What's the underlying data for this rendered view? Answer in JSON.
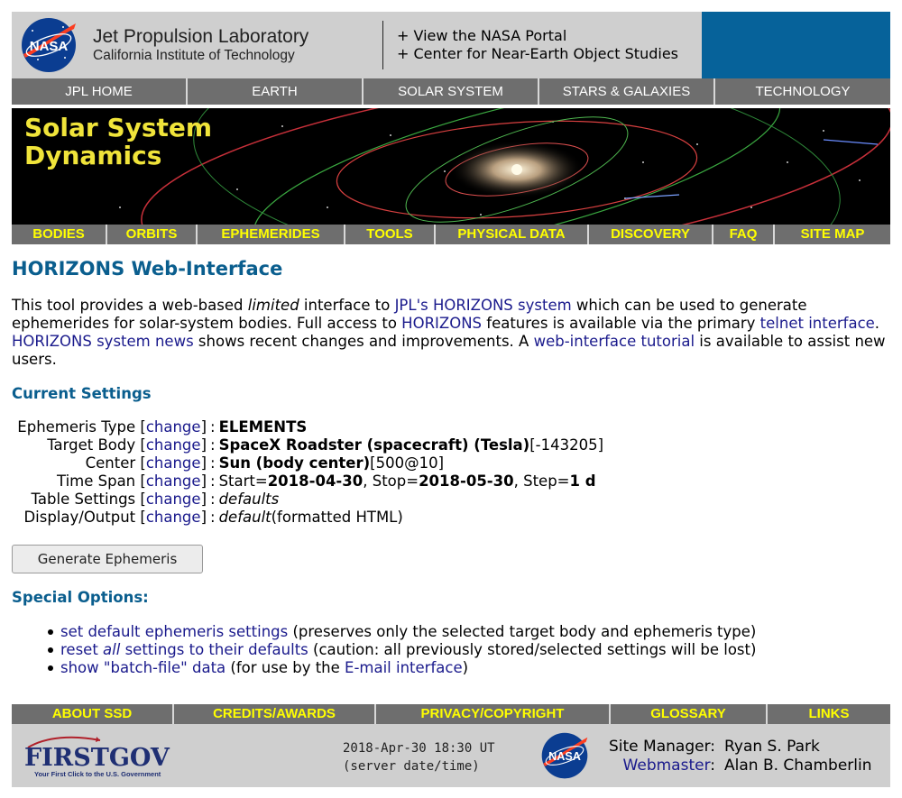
{
  "header": {
    "title": "Jet Propulsion Laboratory",
    "subtitle": "California Institute of Technology",
    "logo_text": "NASA",
    "links": [
      "+ View the NASA Portal",
      "+ Center for Near-Earth Object Studies"
    ]
  },
  "top_nav": [
    "JPL HOME",
    "EARTH",
    "SOLAR SYSTEM",
    "STARS & GALAXIES",
    "TECHNOLOGY"
  ],
  "banner": {
    "title_line1": "Solar System",
    "title_line2": "Dynamics"
  },
  "sub_nav": [
    "BODIES",
    "ORBITS",
    "EPHEMERIDES",
    "TOOLS",
    "PHYSICAL DATA",
    "DISCOVERY",
    "FAQ",
    "SITE MAP"
  ],
  "main": {
    "title": "HORIZONS Web-Interface",
    "intro": {
      "t1": "This tool provides a web-based ",
      "t2": "limited",
      "t3": " interface to ",
      "link_jpl": "JPL's HORIZONS system",
      "t4": " which can be used to generate ephemerides for solar-system bodies. Full access to ",
      "link_horizons": "HORIZONS",
      "t5": " features is available via the primary ",
      "link_telnet": "telnet interface",
      "t6": ". ",
      "link_news": "HORIZONS system news",
      "t7": " shows recent changes and improvements. A ",
      "link_tutorial": "web-interface tutorial",
      "t8": " is available to assist new users."
    },
    "current_settings_title": "Current Settings",
    "settings": {
      "open_bracket": "[",
      "close_bracket": "]",
      "change_label": "change",
      "colon": " : ",
      "ephemeris_type": {
        "label": "Ephemeris Type",
        "value": "ELEMENTS"
      },
      "target_body": {
        "label": "Target Body",
        "value": "SpaceX Roadster (spacecraft) (Tesla)",
        "extra": " [-143205]"
      },
      "center": {
        "label": "Center",
        "value": "Sun (body center)",
        "extra": " [500@10]"
      },
      "time_span": {
        "label": "Time Span",
        "start_label": "Start=",
        "start": "2018-04-30",
        "stop_label": ", Stop=",
        "stop": "2018-05-30",
        "step_label": ", Step=",
        "step": "1 d"
      },
      "table_settings": {
        "label": "Table Settings",
        "value": "defaults"
      },
      "display_output": {
        "label": "Display/Output",
        "value": "default",
        "extra": " (formatted HTML)"
      }
    },
    "generate_button": "Generate Ephemeris",
    "special_options_title": "Special Options:",
    "options": {
      "opt1_link": "set default ephemeris settings",
      "opt1_text": " (preserves only the selected target body and ephemeris type)",
      "opt2_link_a": "reset ",
      "opt2_link_b": "all",
      "opt2_link_c": " settings to their defaults",
      "opt2_text": " (caution: all previously stored/selected settings will be lost)",
      "opt3_link": "show \"batch-file\" data",
      "opt3_text_a": " (for use by the ",
      "opt3_link2": "E-mail interface",
      "opt3_text_b": ")"
    }
  },
  "footer_nav": [
    "ABOUT SSD",
    "CREDITS/AWARDS",
    "PRIVACY/COPYRIGHT",
    "GLOSSARY",
    "LINKS"
  ],
  "footer": {
    "firstgov_text": "FIRSTGOV",
    "firstgov_tagline": "Your First Click to the U.S. Government",
    "server_date": "2018-Apr-30 18:30 UT",
    "server_date_label": "(server date/time)",
    "logo_text": "NASA",
    "site_manager_label": "Site Manager:",
    "site_manager": "Ryan S. Park",
    "webmaster_label": "Webmaster",
    "webmaster_colon": ":",
    "webmaster": "Alan B. Chamberlin"
  },
  "colors": {
    "heading": "#0a5e8e",
    "link": "#1a1a8c",
    "nav_bg": "#6e6e6e",
    "nav_yellow": "#ffff00",
    "header_blue": "#06629a",
    "banner_text": "#f0e43a"
  }
}
